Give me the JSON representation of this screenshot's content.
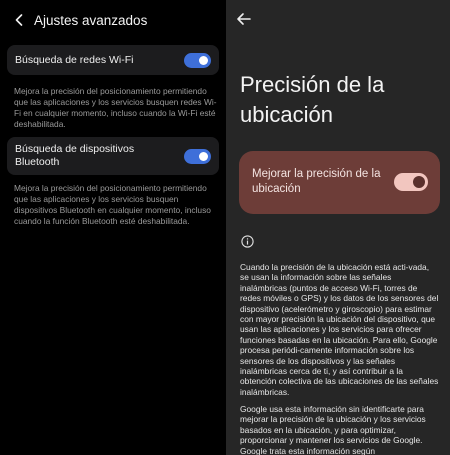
{
  "left": {
    "title": "Ajustes avanzados",
    "wifi": {
      "label": "Búsqueda de redes Wi-Fi",
      "enabled": true,
      "description": "Mejora la precisión del posicionamiento permitiendo que las aplicaciones y los servicios busquen redes Wi-Fi en cualquier momento, incluso cuando la Wi-Fi esté deshabilitada."
    },
    "bluetooth": {
      "label": "Búsqueda de dispositivos Bluetooth",
      "enabled": true,
      "description": "Mejora la precisión del posicionamiento permitiendo que las aplicaciones y los servicios busquen dispositivos Bluetooth en cualquier momento, incluso cuando la función Bluetooth esté deshabilitada."
    }
  },
  "right": {
    "title": "Precisión de la ubicación",
    "toggle_label": "Mejorar la precisión de la ubicación",
    "toggle_enabled": true,
    "paragraph1": "Cuando la precisión de la ubicación está acti-vada, se usan la información sobre las señales inalámbricas (puntos de acceso Wi-Fi, torres de redes móviles o GPS) y los datos de los sensores del dispositivo (acelerómetro y giroscopio) para estimar con mayor precisión la ubicación del dispositivo, que usan las aplicaciones y los servicios para ofrecer funciones basadas en la ubicación. Para ello, Google procesa periódi-camente información sobre los sensores de los dispositivos y las señales inalámbricas cerca de ti, y así contribuir a la obtención colectiva de las ubicaciones de las señales inalámbricas.",
    "paragraph2": "Google usa esta información sin identificarte para mejorar la precisión de la ubicación y los servicios basados en la ubicación, y para optimizar, proporcionar y mantener los servicios de Google. Google trata esta información según"
  },
  "colors": {
    "toggle_blue": "#3e6fd9",
    "card_dark": "#1c1c1e",
    "precision_card": "#6d3d38",
    "toggle_pink": "#f2c6bf"
  },
  "icons": [
    "back-arrow-icon",
    "info-icon"
  ]
}
